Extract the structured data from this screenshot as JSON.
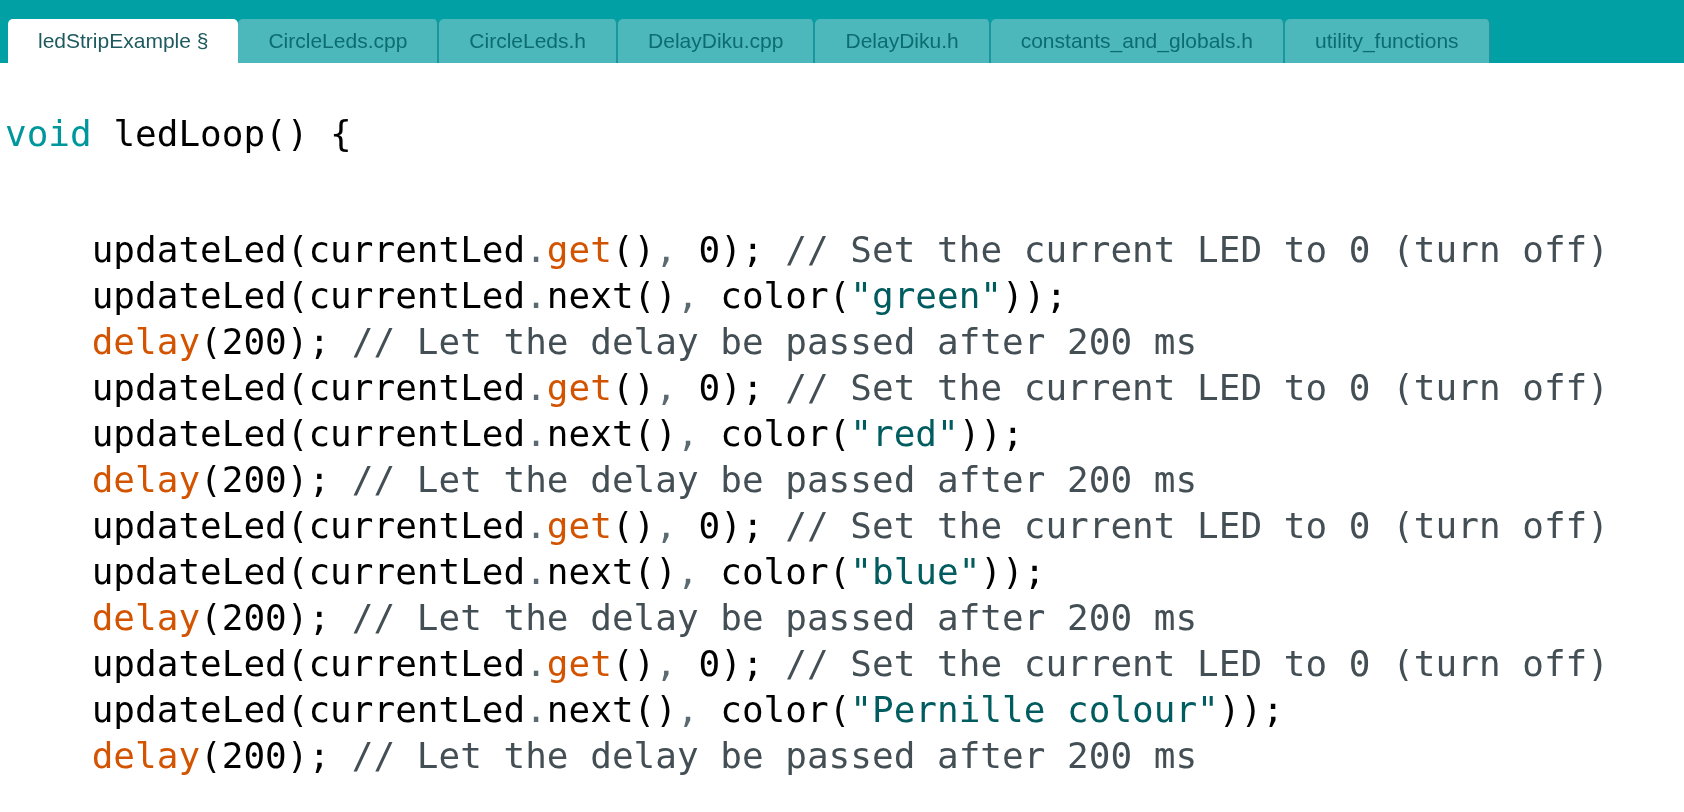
{
  "tabs": [
    {
      "label": "ledStripExample §",
      "selected": true
    },
    {
      "label": "CircleLeds.cpp",
      "selected": false
    },
    {
      "label": "CircleLeds.h",
      "selected": false
    },
    {
      "label": "DelayDiku.cpp",
      "selected": false
    },
    {
      "label": "DelayDiku.h",
      "selected": false
    },
    {
      "label": "constants_and_globals.h",
      "selected": false
    },
    {
      "label": "utility_functions",
      "selected": false
    }
  ],
  "code_lines": [
    {
      "kind": "code",
      "tokens": [
        {
          "kind": "keyword",
          "text": "void"
        },
        {
          "kind": "text",
          "text": " ledLoop() {"
        }
      ]
    },
    {
      "kind": "blank"
    },
    {
      "kind": "code",
      "tokens": [
        {
          "kind": "text",
          "text": "    updateLed(currentLed"
        },
        {
          "kind": "punct",
          "text": "."
        },
        {
          "kind": "func",
          "text": "get"
        },
        {
          "kind": "text",
          "text": "()"
        },
        {
          "kind": "punct",
          "text": ","
        },
        {
          "kind": "text",
          "text": " 0); "
        },
        {
          "kind": "comment",
          "text": "// Set the current LED to 0 (turn off)"
        }
      ]
    },
    {
      "kind": "code",
      "tokens": [
        {
          "kind": "text",
          "text": "    updateLed(currentLed"
        },
        {
          "kind": "punct",
          "text": "."
        },
        {
          "kind": "text",
          "text": "next()"
        },
        {
          "kind": "punct",
          "text": ","
        },
        {
          "kind": "text",
          "text": " color("
        },
        {
          "kind": "string",
          "text": "\"green\""
        },
        {
          "kind": "text",
          "text": "));"
        }
      ]
    },
    {
      "kind": "code",
      "tokens": [
        {
          "kind": "func",
          "text": "    delay"
        },
        {
          "kind": "text",
          "text": "(200); "
        },
        {
          "kind": "comment",
          "text": "// Let the delay be passed after 200 ms"
        }
      ]
    },
    {
      "kind": "code",
      "tokens": [
        {
          "kind": "text",
          "text": "    updateLed(currentLed"
        },
        {
          "kind": "punct",
          "text": "."
        },
        {
          "kind": "func",
          "text": "get"
        },
        {
          "kind": "text",
          "text": "()"
        },
        {
          "kind": "punct",
          "text": ","
        },
        {
          "kind": "text",
          "text": " 0); "
        },
        {
          "kind": "comment",
          "text": "// Set the current LED to 0 (turn off)"
        }
      ]
    },
    {
      "kind": "code",
      "tokens": [
        {
          "kind": "text",
          "text": "    updateLed(currentLed"
        },
        {
          "kind": "punct",
          "text": "."
        },
        {
          "kind": "text",
          "text": "next()"
        },
        {
          "kind": "punct",
          "text": ","
        },
        {
          "kind": "text",
          "text": " color("
        },
        {
          "kind": "string",
          "text": "\"red\""
        },
        {
          "kind": "text",
          "text": "));"
        }
      ]
    },
    {
      "kind": "code",
      "tokens": [
        {
          "kind": "func",
          "text": "    delay"
        },
        {
          "kind": "text",
          "text": "(200); "
        },
        {
          "kind": "comment",
          "text": "// Let the delay be passed after 200 ms"
        }
      ]
    },
    {
      "kind": "code",
      "tokens": [
        {
          "kind": "text",
          "text": "    updateLed(currentLed"
        },
        {
          "kind": "punct",
          "text": "."
        },
        {
          "kind": "func",
          "text": "get"
        },
        {
          "kind": "text",
          "text": "()"
        },
        {
          "kind": "punct",
          "text": ","
        },
        {
          "kind": "text",
          "text": " 0); "
        },
        {
          "kind": "comment",
          "text": "// Set the current LED to 0 (turn off)"
        }
      ]
    },
    {
      "kind": "code",
      "tokens": [
        {
          "kind": "text",
          "text": "    updateLed(currentLed"
        },
        {
          "kind": "punct",
          "text": "."
        },
        {
          "kind": "text",
          "text": "next()"
        },
        {
          "kind": "punct",
          "text": ","
        },
        {
          "kind": "text",
          "text": " color("
        },
        {
          "kind": "string",
          "text": "\"blue\""
        },
        {
          "kind": "text",
          "text": "));"
        }
      ]
    },
    {
      "kind": "code",
      "tokens": [
        {
          "kind": "func",
          "text": "    delay"
        },
        {
          "kind": "text",
          "text": "(200); "
        },
        {
          "kind": "comment",
          "text": "// Let the delay be passed after 200 ms"
        }
      ]
    },
    {
      "kind": "code",
      "tokens": [
        {
          "kind": "text",
          "text": "    updateLed(currentLed"
        },
        {
          "kind": "punct",
          "text": "."
        },
        {
          "kind": "func",
          "text": "get"
        },
        {
          "kind": "text",
          "text": "()"
        },
        {
          "kind": "punct",
          "text": ","
        },
        {
          "kind": "text",
          "text": " 0); "
        },
        {
          "kind": "comment",
          "text": "// Set the current LED to 0 (turn off)"
        }
      ]
    },
    {
      "kind": "code",
      "tokens": [
        {
          "kind": "text",
          "text": "    updateLed(currentLed"
        },
        {
          "kind": "punct",
          "text": "."
        },
        {
          "kind": "text",
          "text": "next()"
        },
        {
          "kind": "punct",
          "text": ","
        },
        {
          "kind": "text",
          "text": " color("
        },
        {
          "kind": "string",
          "text": "\"Pernille colour\""
        },
        {
          "kind": "text",
          "text": "));"
        }
      ]
    },
    {
      "kind": "code",
      "tokens": [
        {
          "kind": "func",
          "text": "    delay"
        },
        {
          "kind": "text",
          "text": "(200); "
        },
        {
          "kind": "comment",
          "text": "// Let the delay be passed after 200 ms"
        }
      ]
    }
  ]
}
